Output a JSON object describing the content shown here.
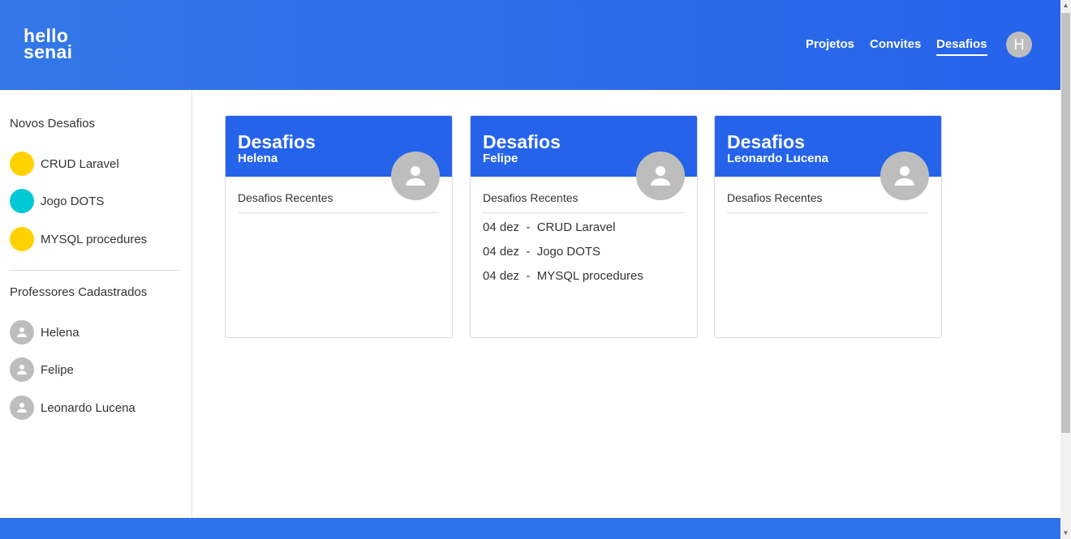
{
  "header": {
    "logo_line1": "hello",
    "logo_line2": "senai",
    "nav": [
      "Projetos",
      "Convites",
      "Desafios"
    ],
    "active_nav": "Desafios",
    "user_initial": "H"
  },
  "sidebar": {
    "new_challenges_heading": "Novos Desafios",
    "challenges": [
      {
        "label": "CRUD Laravel",
        "color": "#ffd200"
      },
      {
        "label": "Jogo DOTS",
        "color": "#00c9d6"
      },
      {
        "label": "MYSQL procedures",
        "color": "#ffd200"
      }
    ],
    "teachers_heading": "Professores Cadastrados",
    "teachers": [
      "Helena",
      "Felipe",
      "Leonardo Lucena"
    ]
  },
  "cards": [
    {
      "title": "Desafios",
      "name": "Helena",
      "recent_label": "Desafios Recentes",
      "entries": []
    },
    {
      "title": "Desafios",
      "name": "Felipe",
      "recent_label": "Desafios Recentes",
      "entries": [
        "04 dez  -  CRUD Laravel",
        "04 dez  -  Jogo DOTS",
        "04 dez  -  MYSQL procedures"
      ]
    },
    {
      "title": "Desafios",
      "name": "Leonardo Lucena",
      "recent_label": "Desafios Recentes",
      "entries": []
    }
  ],
  "colors": {
    "primary": "#2563eb",
    "avatar_gray": "#bdbdbd"
  },
  "icons": {
    "person": "person-icon"
  }
}
